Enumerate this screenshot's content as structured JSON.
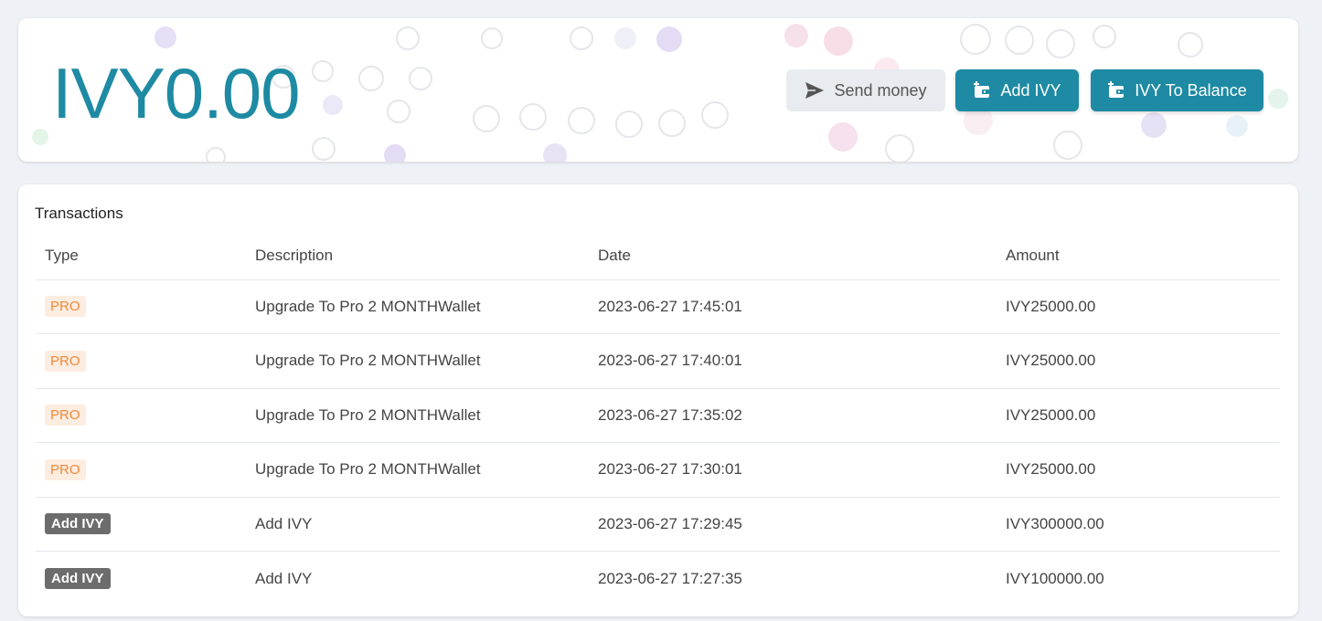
{
  "balance": {
    "amount": "IVY0.00"
  },
  "actions": {
    "send_label": "Send money",
    "add_label": "Add IVY",
    "to_balance_label": "IVY To Balance"
  },
  "colors": {
    "accent": "#1e8aa3",
    "pro_badge_bg": "#fdece0",
    "pro_badge_text": "#ef8a3a",
    "add_badge_bg": "#6c6c6c"
  },
  "transactions": {
    "title": "Transactions",
    "columns": [
      "Type",
      "Description",
      "Date",
      "Amount"
    ],
    "rows": [
      {
        "type": "PRO",
        "badge": "pro",
        "description": "Upgrade To Pro 2 MONTHWallet",
        "date": "2023-06-27 17:45:01",
        "amount": "IVY25000.00"
      },
      {
        "type": "PRO",
        "badge": "pro",
        "description": "Upgrade To Pro 2 MONTHWallet",
        "date": "2023-06-27 17:40:01",
        "amount": "IVY25000.00"
      },
      {
        "type": "PRO",
        "badge": "pro",
        "description": "Upgrade To Pro 2 MONTHWallet",
        "date": "2023-06-27 17:35:02",
        "amount": "IVY25000.00"
      },
      {
        "type": "PRO",
        "badge": "pro",
        "description": "Upgrade To Pro 2 MONTHWallet",
        "date": "2023-06-27 17:30:01",
        "amount": "IVY25000.00"
      },
      {
        "type": "Add IVY",
        "badge": "add",
        "description": "Add IVY",
        "date": "2023-06-27 17:29:45",
        "amount": "IVY300000.00"
      },
      {
        "type": "Add IVY",
        "badge": "add",
        "description": "Add IVY",
        "date": "2023-06-27 17:27:35",
        "amount": "IVY100000.00"
      }
    ]
  }
}
